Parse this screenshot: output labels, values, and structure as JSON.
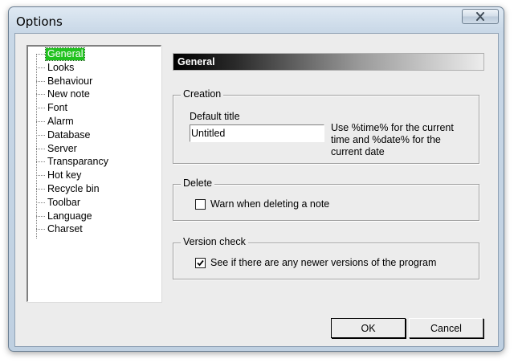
{
  "window": {
    "title": "Options"
  },
  "tree": {
    "items": [
      {
        "label": "General",
        "selected": true
      },
      {
        "label": "Looks"
      },
      {
        "label": "Behaviour"
      },
      {
        "label": "New note"
      },
      {
        "label": "Font"
      },
      {
        "label": "Alarm"
      },
      {
        "label": "Database"
      },
      {
        "label": "Server"
      },
      {
        "label": "Transparancy"
      },
      {
        "label": "Hot key"
      },
      {
        "label": "Recycle bin"
      },
      {
        "label": "Toolbar"
      },
      {
        "label": "Language"
      },
      {
        "label": "Charset"
      }
    ]
  },
  "panel": {
    "header": "General",
    "creation": {
      "legend": "Creation",
      "default_title_label": "Default title",
      "default_title_value": "Untitled",
      "hint": "Use %time% for the current time and %date% for the current date"
    },
    "delete": {
      "legend": "Delete",
      "warn_label": "Warn when deleting a note",
      "warn_checked": false
    },
    "version": {
      "legend": "Version check",
      "check_label": "See if there are any newer versions of the program",
      "check_checked": true
    }
  },
  "buttons": {
    "ok": "OK",
    "cancel": "Cancel"
  }
}
